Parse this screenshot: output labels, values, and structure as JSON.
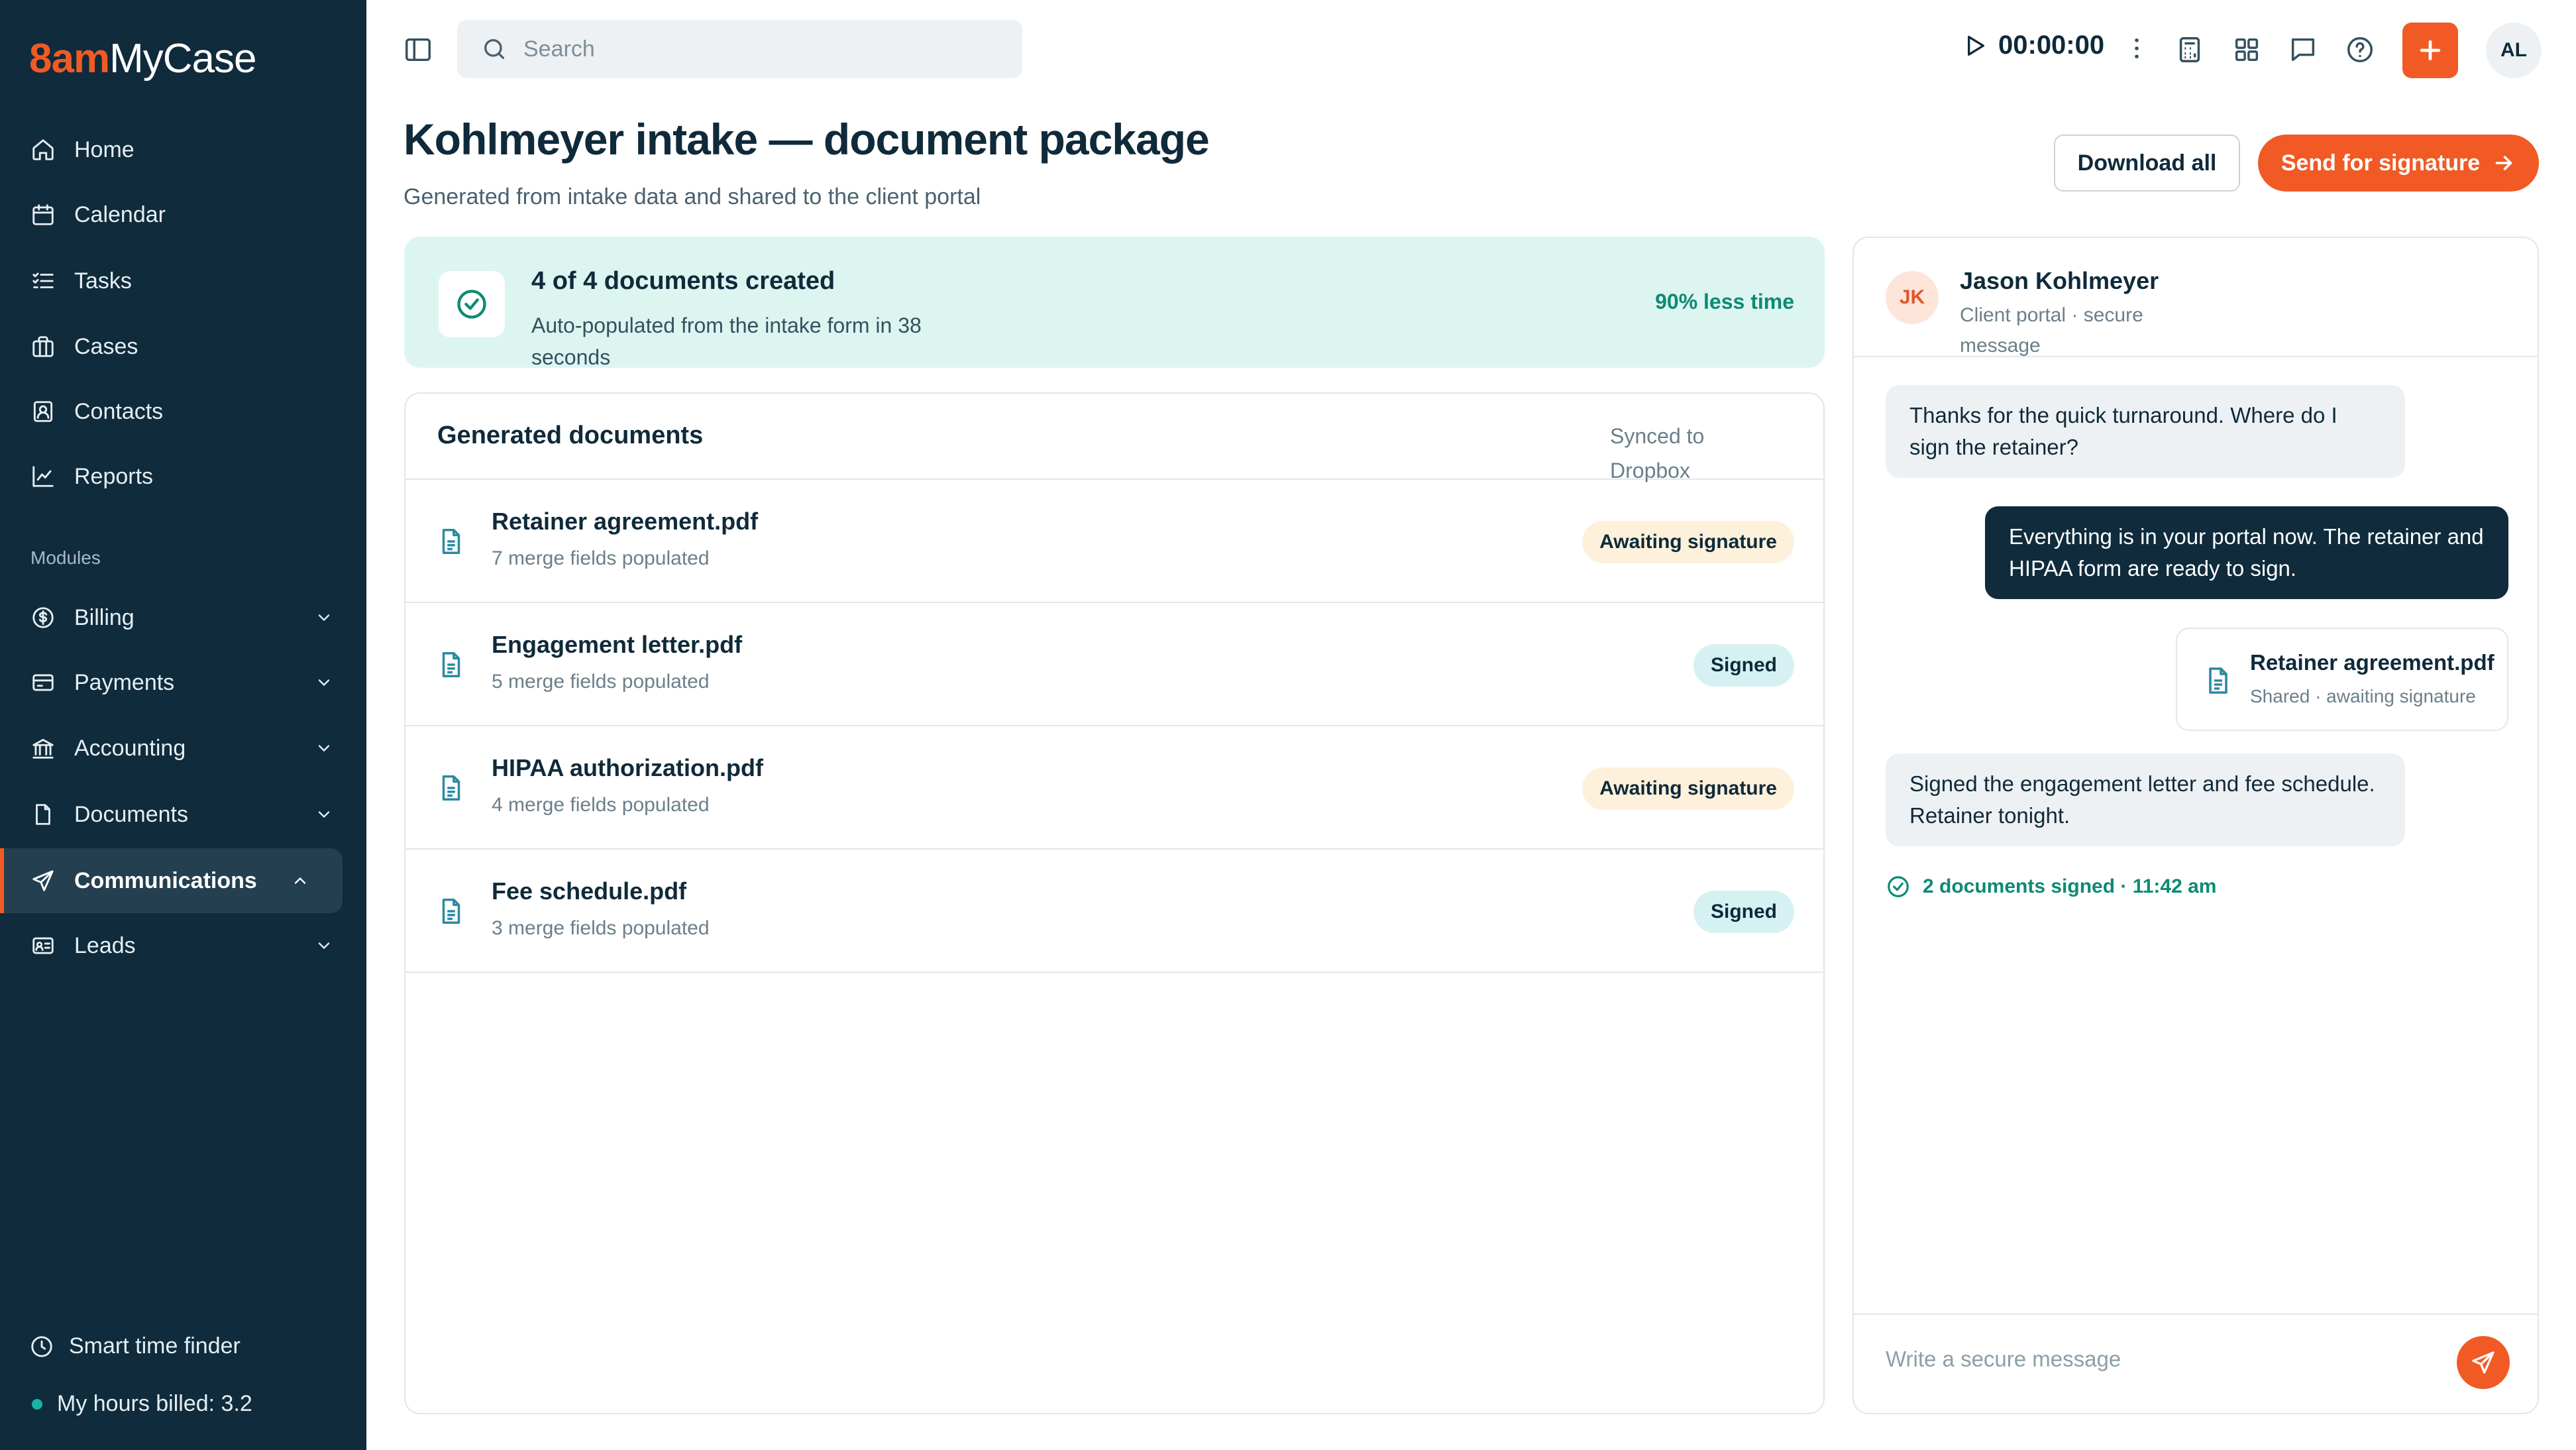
{
  "brand": {
    "mark": "8am",
    "name": "MyCase",
    "accent": "#f15a24",
    "sidebar_bg": "#0f2b3c"
  },
  "sidebar": {
    "items": [
      {
        "label": "Home",
        "icon": "home-icon"
      },
      {
        "label": "Calendar",
        "icon": "calendar-icon"
      },
      {
        "label": "Tasks",
        "icon": "tasks-icon"
      },
      {
        "label": "Cases",
        "icon": "briefcase-icon"
      },
      {
        "label": "Contacts",
        "icon": "contacts-icon"
      },
      {
        "label": "Reports",
        "icon": "chart-line-icon"
      }
    ],
    "modules_label": "Modules",
    "modules": [
      {
        "label": "Billing",
        "icon": "dollar-icon",
        "expanded": false
      },
      {
        "label": "Payments",
        "icon": "credit-card-icon",
        "expanded": false
      },
      {
        "label": "Accounting",
        "icon": "bank-icon",
        "expanded": false
      },
      {
        "label": "Documents",
        "icon": "document-icon",
        "expanded": false
      },
      {
        "label": "Communications",
        "icon": "send-icon",
        "expanded": true,
        "active": true
      },
      {
        "label": "Leads",
        "icon": "id-card-icon",
        "expanded": false
      }
    ],
    "smart_time_finder": "Smart time finder",
    "hours_billed": "My hours billed: 3.2"
  },
  "topbar": {
    "search_placeholder": "Search",
    "timer": "00:00:00",
    "avatar_initials": "AL"
  },
  "page": {
    "title": "Kohlmeyer intake — document package",
    "subtitle": "Generated from intake data and shared to the client portal",
    "download_all": "Download all",
    "send_for_signature": "Send for signature"
  },
  "banner": {
    "title": "4 of 4 documents created",
    "subtitle": "Auto-populated from the intake form in 38 seconds",
    "metric": "90% less time"
  },
  "documents": {
    "header": "Generated documents",
    "sync_status": "Synced to Dropbox",
    "rows": [
      {
        "name": "Retainer agreement.pdf",
        "sub": "7 merge fields populated",
        "status": "Awaiting signature",
        "status_type": "awaiting"
      },
      {
        "name": "Engagement letter.pdf",
        "sub": "5 merge fields populated",
        "status": "Signed",
        "status_type": "signed"
      },
      {
        "name": "HIPAA authorization.pdf",
        "sub": "4 merge fields populated",
        "status": "Awaiting signature",
        "status_type": "awaiting"
      },
      {
        "name": "Fee schedule.pdf",
        "sub": "3 merge fields populated",
        "status": "Signed",
        "status_type": "signed"
      }
    ]
  },
  "chat": {
    "contact_initials": "JK",
    "contact_name": "Jason Kohlmeyer",
    "contact_sub": "Client portal · secure message",
    "messages": [
      {
        "dir": "in",
        "text": "Thanks for the quick turnaround. Where do I sign the retainer?"
      },
      {
        "dir": "out",
        "text": "Everything is in your portal now. The retainer and HIPAA form are ready to sign."
      },
      {
        "dir": "in",
        "text": "Signed the engagement letter and fee schedule. Retainer tonight."
      }
    ],
    "attachment": {
      "name": "Retainer agreement.pdf",
      "sub": "Shared · awaiting signature"
    },
    "signed_status": "2 documents signed · 11:42 am",
    "composer_placeholder": "Write a secure message"
  }
}
